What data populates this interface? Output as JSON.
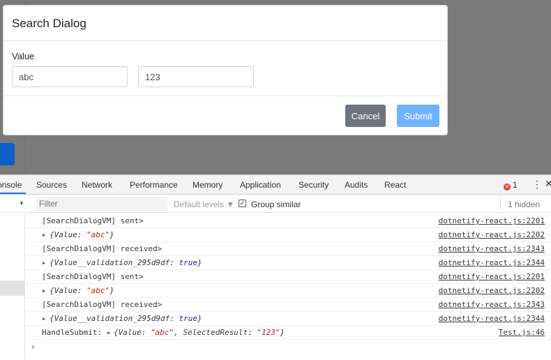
{
  "dialog": {
    "title": "Search Dialog",
    "value_label": "Value",
    "value_input": "abc",
    "result_input": "123",
    "cancel_label": "Cancel",
    "submit_label": "Submit"
  },
  "devtools": {
    "tabs": [
      "onsole",
      "Sources",
      "Network",
      "Performance",
      "Memory",
      "Application",
      "Security",
      "Audits",
      "React"
    ],
    "active_tab": "Console",
    "error_count": "1",
    "filter_placeholder": "Filter",
    "levels_label": "Default levels ▼",
    "group_similar_label": "Group similar",
    "group_similar_checked": true,
    "hidden_count": "1 hidden"
  },
  "console": {
    "rows": [
      {
        "text": "[SearchDialogVM] sent>",
        "source": "dotnetify-react.js:2201"
      },
      {
        "obj_key": "Value",
        "obj_val": "\"abc\"",
        "val_type": "string",
        "source": "dotnetify-react.js:2202"
      },
      {
        "text": "[SearchDialogVM] received>",
        "source": "dotnetify-react.js:2343"
      },
      {
        "obj_key": "Value__validation_295d9df",
        "obj_val": "true",
        "val_type": "bool",
        "source": "dotnetify-react.js:2344"
      },
      {
        "text": "[SearchDialogVM] sent>",
        "source": "dotnetify-react.js:2201"
      },
      {
        "obj_key": "Value",
        "obj_val": "\"abc\"",
        "val_type": "string",
        "source": "dotnetify-react.js:2202"
      },
      {
        "text": "[SearchDialogVM] received>",
        "source": "dotnetify-react.js:2343"
      },
      {
        "obj_key": "Value__validation_295d9df",
        "obj_val": "true",
        "val_type": "bool",
        "source": "dotnetify-react.js:2344"
      }
    ],
    "submit_row": {
      "text": "HandleSubmit:",
      "key1": "Value",
      "val1": "\"abc\"",
      "key2": "SelectedResult",
      "val2": "\"123\"",
      "source": "Test.js:46"
    }
  },
  "icons": {
    "expand": "triangle-right-icon",
    "error": "error-circle-icon",
    "more": "kebab-menu-icon",
    "prompt": "chevron-right-icon"
  }
}
